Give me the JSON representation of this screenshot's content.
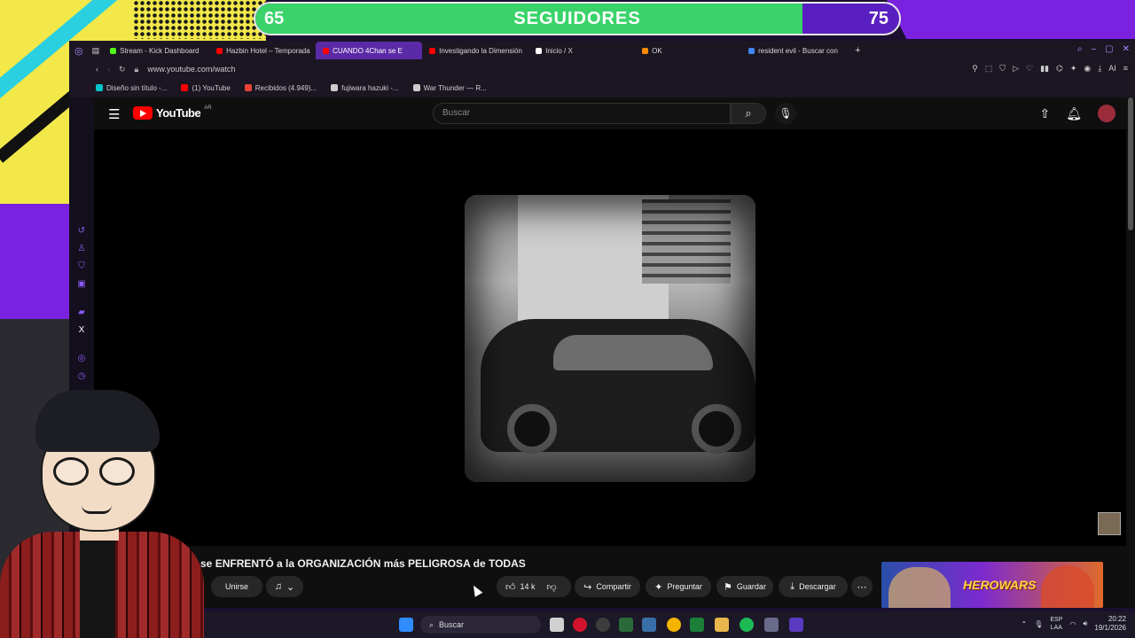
{
  "overlay": {
    "goal_start": "65",
    "goal_label": "SEGUIDORES",
    "goal_end": "75",
    "goal_progress": 0.85,
    "colors": {
      "fill": "#3ad36a",
      "track": "#5a1fc0"
    }
  },
  "browser": {
    "tabs": [
      {
        "label": "Stream - Kick Dashboard",
        "icon": "kick-icon",
        "color": "#53fc18"
      },
      {
        "label": "Hazbin Hotel – Temporada",
        "icon": "youtube-icon",
        "color": "#ff0000"
      },
      {
        "label": "CUANDO 4Chan se E",
        "icon": "youtube-icon",
        "color": "#ff0000",
        "active": true
      },
      {
        "label": "Investigando la Dimensión",
        "icon": "youtube-icon",
        "color": "#ff0000"
      },
      {
        "label": "Inicio / X",
        "icon": "x-icon",
        "color": "#ffffff"
      },
      {
        "label": "OK",
        "icon": "blogger-icon",
        "color": "#ff8a00"
      },
      {
        "label": "resident evil - Buscar con",
        "icon": "google-icon",
        "color": "#4285f4"
      }
    ],
    "url": "www.youtube.com/watch",
    "bookmarks": [
      {
        "label": "Diseño sin título -...",
        "icon": "canva-icon",
        "color": "#00c4cc"
      },
      {
        "label": "(1) YouTube",
        "icon": "youtube-icon",
        "color": "#ff0000"
      },
      {
        "label": "Recibidos (4.949)...",
        "icon": "gmail-icon",
        "color": "#ea4335"
      },
      {
        "label": "fujiwara hazuki -...",
        "icon": "page-icon",
        "color": "#cccccc"
      },
      {
        "label": "War Thunder — R...",
        "icon": "warthunder-icon",
        "color": "#cccccc"
      }
    ]
  },
  "youtube": {
    "logo_text": "YouTube",
    "region": "AR",
    "search_placeholder": "Buscar",
    "video_title": "4Chan se ENFRENTÓ a la ORGANIZACIÓN más PELIGROSA de TODAS",
    "join_label": "Unirse",
    "likes": "14 k",
    "share_label": "Compartir",
    "ask_label": "Preguntar",
    "save_label": "Guardar",
    "download_label": "Descargar",
    "ad_text": "HEROWARS"
  },
  "taskbar": {
    "search_label": "Buscar",
    "lang_top": "ESP",
    "lang_bottom": "LAA",
    "time": "20:22",
    "date": "19/1/2026"
  }
}
